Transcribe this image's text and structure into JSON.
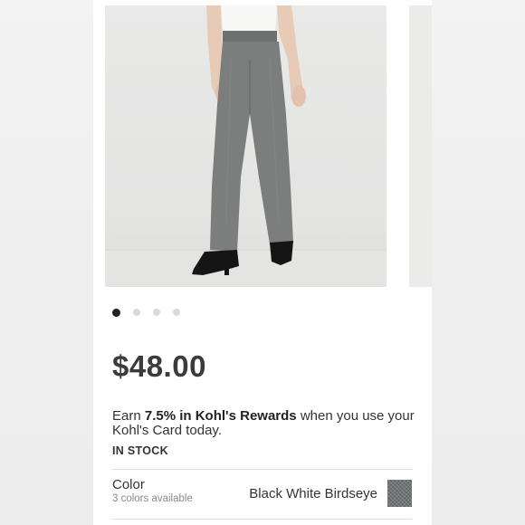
{
  "product": {
    "image_alt": "Woman wearing gray birdseye trousers with black heels",
    "carousel": {
      "total": 4,
      "active": 0
    },
    "price": "$48.00",
    "rewards": {
      "prefix": "Earn ",
      "highlight": "7.5% in Kohl's Rewards",
      "suffix": " when you use your Kohl's Card today."
    },
    "stock_status": "IN STOCK",
    "color": {
      "label": "Color",
      "available": "3 colors available",
      "selected": "Black White Birdseye",
      "swatch_icon": "birdseye-swatch"
    }
  },
  "colors": {
    "price": "#3b3b3b",
    "text": "#333333",
    "muted": "#8a8a8a",
    "dot_active": "#222222",
    "dot_inactive": "#dadada",
    "swatch": "#6f7373"
  }
}
